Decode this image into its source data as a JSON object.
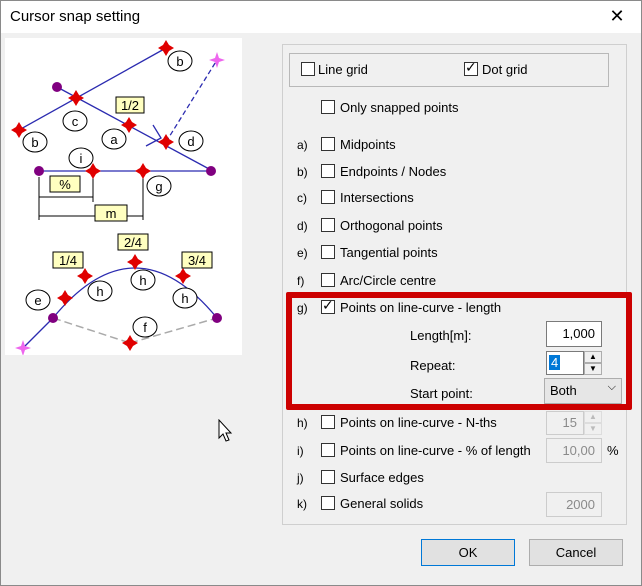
{
  "window": {
    "title": "Cursor snap setting",
    "close_glyph": "✕"
  },
  "illustration": {
    "labels": [
      "b",
      "c",
      "1/2",
      "a",
      "b",
      "d",
      "i",
      "%",
      "g",
      "m",
      "2/4",
      "1/4",
      "3/4",
      "h",
      "h",
      "h",
      "e",
      "f"
    ]
  },
  "grid": {
    "line_grid": {
      "label": "Line grid",
      "checked": false
    },
    "dot_grid": {
      "label": "Dot grid",
      "checked": true
    }
  },
  "only_snapped": {
    "label": "Only snapped points",
    "checked": false
  },
  "options": [
    {
      "key": "a)",
      "label": "Midpoints",
      "checked": false
    },
    {
      "key": "b)",
      "label": "Endpoints / Nodes",
      "checked": false
    },
    {
      "key": "c)",
      "label": "Intersections",
      "checked": false
    },
    {
      "key": "d)",
      "label": "Orthogonal points",
      "checked": false
    },
    {
      "key": "e)",
      "label": "Tangential points",
      "checked": false
    },
    {
      "key": "f)",
      "label": "Arc/Circle centre",
      "checked": false
    },
    {
      "key": "g)",
      "label": "Points on line-curve - length",
      "checked": true
    },
    {
      "key": "h)",
      "label": "Points on line-curve - N-ths",
      "checked": false
    },
    {
      "key": "i)",
      "label": "Points on line-curve - % of length",
      "checked": false
    },
    {
      "key": "j)",
      "label": "Surface edges",
      "checked": false
    },
    {
      "key": "k)",
      "label": "General solids",
      "checked": false
    }
  ],
  "length_settings": {
    "length_label": "Length[m]:",
    "length_value": "1,000",
    "repeat_label": "Repeat:",
    "repeat_value": "4",
    "start_label": "Start point:",
    "start_value": "Both"
  },
  "nths_value": "15",
  "percent_value": "10,00",
  "percent_unit": "%",
  "solids_value": "2000",
  "buttons": {
    "ok": "OK",
    "cancel": "Cancel"
  },
  "colors": {
    "highlight": "#cc0000",
    "snap_marker": "#e00000",
    "node": "#800080",
    "line": "#2b2bb0",
    "label_bg": "#ffffc0"
  }
}
